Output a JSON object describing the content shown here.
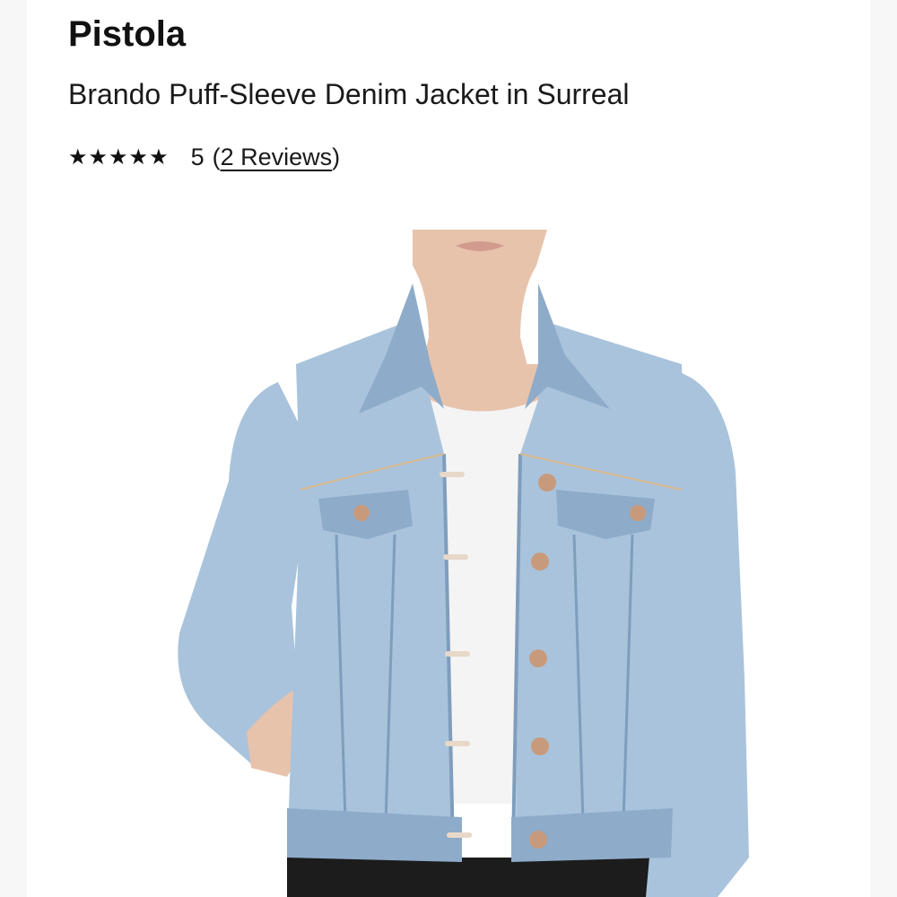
{
  "product": {
    "brand": "Pistola",
    "name": "Brando Puff-Sleeve Denim Jacket in Surreal",
    "stars": "★★★★★",
    "rating": "5",
    "open_paren": "(",
    "reviews_label": "2 Reviews",
    "close_paren": ")"
  },
  "image": {
    "subject": "model wearing light-wash denim jacket over white tee",
    "colors": {
      "denim": "#a9c3dc",
      "denim_shadow": "#8eabc9",
      "stitch": "#d9b98c",
      "button": "#c89a7c",
      "tee": "#f4f4f4",
      "skin": "#e7c3ac",
      "pants": "#1c1c1c"
    }
  }
}
